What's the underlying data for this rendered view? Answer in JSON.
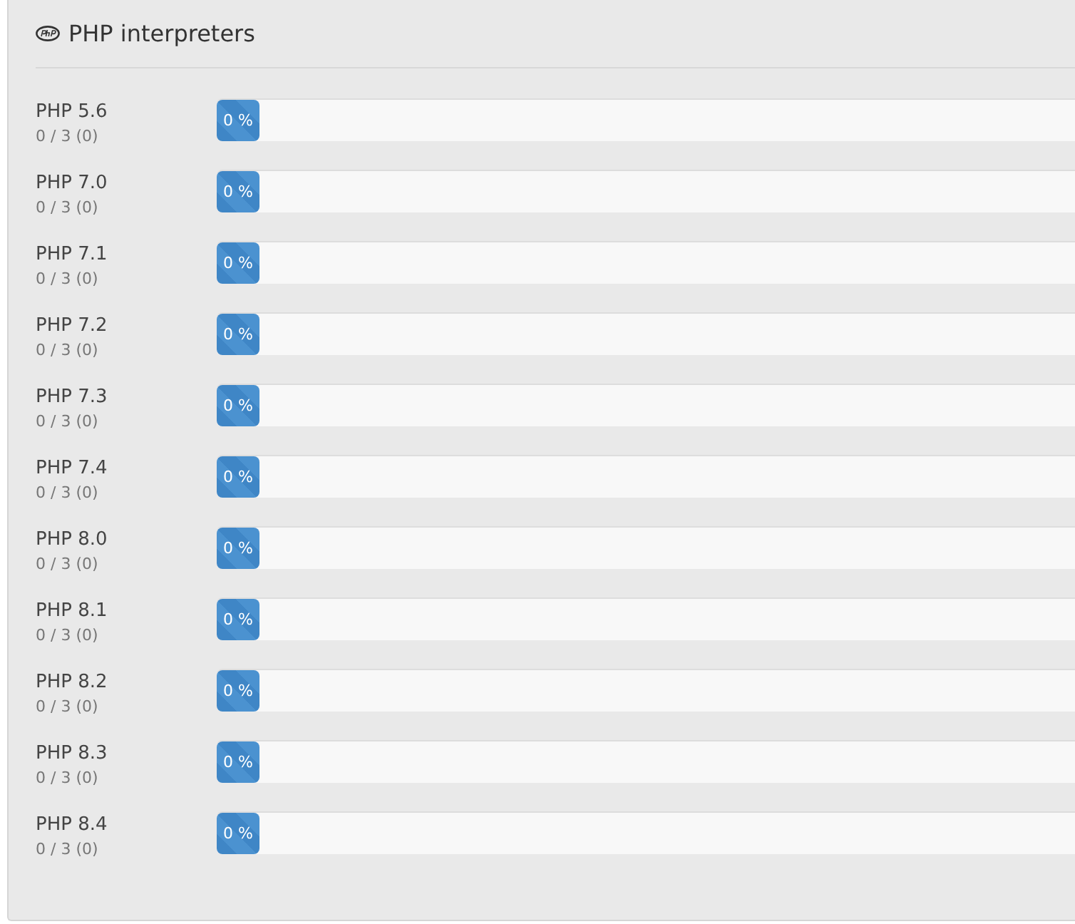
{
  "panel": {
    "title": "PHP interpreters"
  },
  "interpreters": [
    {
      "name": "PHP 5.6",
      "count": "0 / 3 (0)",
      "level": 0,
      "reading": "0 %"
    },
    {
      "name": "PHP 7.0",
      "count": "0 / 3 (0)",
      "level": 0,
      "reading": "0 %"
    },
    {
      "name": "PHP 7.1",
      "count": "0 / 3 (0)",
      "level": 0,
      "reading": "0 %"
    },
    {
      "name": "PHP 7.2",
      "count": "0 / 3 (0)",
      "level": 0,
      "reading": "0 %"
    },
    {
      "name": "PHP 7.3",
      "count": "0 / 3 (0)",
      "level": 0,
      "reading": "0 %"
    },
    {
      "name": "PHP 7.4",
      "count": "0 / 3 (0)",
      "level": 0,
      "reading": "0 %"
    },
    {
      "name": "PHP 8.0",
      "count": "0 / 3 (0)",
      "level": 0,
      "reading": "0 %"
    },
    {
      "name": "PHP 8.1",
      "count": "0 / 3 (0)",
      "level": 0,
      "reading": "0 %"
    },
    {
      "name": "PHP 8.2",
      "count": "0 / 3 (0)",
      "level": 0,
      "reading": "0 %"
    },
    {
      "name": "PHP 8.3",
      "count": "0 / 3 (0)",
      "level": 0,
      "reading": "0 %"
    },
    {
      "name": "PHP 8.4",
      "count": "0 / 3 (0)",
      "level": 0,
      "reading": "0 %"
    }
  ]
}
